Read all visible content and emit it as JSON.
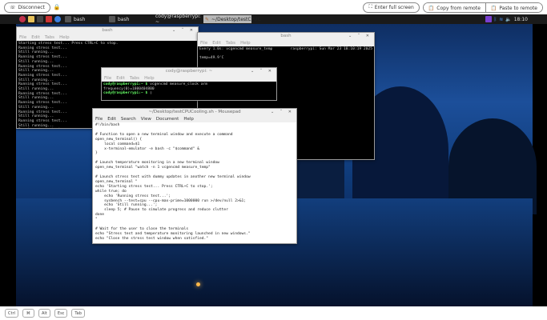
{
  "toolbar": {
    "disconnect": "Disconnect",
    "fullscreen": "Enter full screen",
    "copy": "Copy from remote",
    "paste": "Paste to remote"
  },
  "taskbar": {
    "items": [
      "bash",
      "bash",
      "cody@raspberrypi: ~",
      "~/Desktop/testCPUC"
    ],
    "clock": "18:10"
  },
  "win_bash1": {
    "title": "bash",
    "menu": [
      "File",
      "Edit",
      "Tabs",
      "Help"
    ],
    "lines": [
      "Starting stress test... Press CTRL+C to stop.",
      "Running stress test...",
      "Still running...",
      "Running stress test...",
      "Still running...",
      "Running stress test...",
      "Still running...",
      "Running stress test...",
      "Still running...",
      "Running stress test...",
      "Still running...",
      "Running stress test...",
      "Still running...",
      "Running stress test...",
      "Still running...",
      "Running stress test...",
      "Still running...",
      "Running stress test...",
      "Still running...",
      "Running stress test..."
    ]
  },
  "win_bash2": {
    "title": "bash",
    "menu": [
      "File",
      "Edit",
      "Tabs",
      "Help"
    ],
    "header_left": "Every 1.0s: vcgencmd measure_temp",
    "header_right": "raspberrypi: Sun Mar 23 18:10:19 2025",
    "temp": "temp=49.9'C"
  },
  "win_cody": {
    "title": "cody@raspberrypi: ~",
    "menu": [
      "File",
      "Edit",
      "Tabs",
      "Help"
    ],
    "prompt": "cody@raspberrypi:~ $",
    "cmd": " vcgencmd measure_clock arm",
    "output": "frequency(0)=1800404800"
  },
  "win_editor": {
    "title": "~/Desktop/testCPUCooling.sh - Mousepad",
    "menu": [
      "File",
      "Edit",
      "Search",
      "View",
      "Document",
      "Help"
    ],
    "code": "#!/bin/bash\n\n# Function to open a new terminal window and execute a command\nopen_new_terminal() {\n    local command=$1\n    x-terminal-emulator -e bash -c \"$command\" &\n}\n\n# Launch temperature monitoring in a new terminal window\nopen_new_terminal \"watch -n 1 vcgencmd measure_temp\"\n\n# Launch stress test with dummy updates in another new terminal window\nopen_new_terminal \"\necho 'Starting stress test... Press CTRL+C to stop.';\nwhile true; do\n    echo 'Running stress test...';\n    sysbench --test=cpu --cpu-max-prime=1000000 run >/dev/null 2>&1;\n    echo 'Still running...';\n    sleep 5; # Pause to simulate progress and reduce clutter\ndone\n\"\n\n# Wait for the user to close the terminals\necho \"Stress test and temperature monitoring launched in new windows.\"\necho \"Close the stress test window when satisfied.\""
  },
  "keys": [
    "Ctrl",
    "⌘",
    "Alt",
    "Esc",
    "Tab"
  ]
}
